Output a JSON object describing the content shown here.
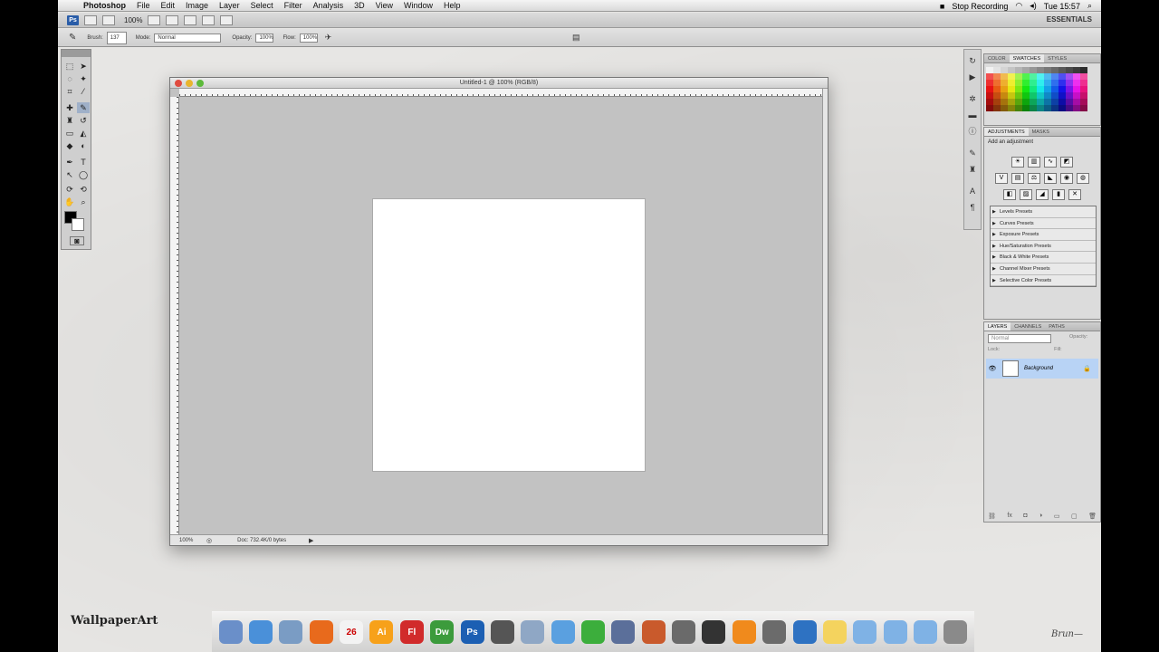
{
  "menubar": {
    "app": "Photoshop",
    "items": [
      "File",
      "Edit",
      "Image",
      "Layer",
      "Select",
      "Filter",
      "Analysis",
      "3D",
      "View",
      "Window",
      "Help"
    ],
    "stop_recording": "Stop Recording",
    "clock": "Tue 15:57"
  },
  "appbar": {
    "zoom": "100%",
    "workspace": "ESSENTIALS"
  },
  "options": {
    "brush_label": "Brush:",
    "brush_size": "137",
    "mode_label": "Mode:",
    "mode_value": "Normal",
    "opacity_label": "Opacity:",
    "opacity_value": "100%",
    "flow_label": "Flow:",
    "flow_value": "100%"
  },
  "document": {
    "title": "Untitled-1 @ 100% (RGB/8)",
    "zoom": "100%",
    "status": "Doc: 732.4K/0 bytes"
  },
  "swatch_panel": {
    "tabs": [
      "COLOR",
      "SWATCHES",
      "STYLES"
    ],
    "active": "SWATCHES"
  },
  "adjust_panel": {
    "tabs": [
      "ADJUSTMENTS",
      "MASKS"
    ],
    "header": "Add an adjustment",
    "presets": [
      "Levels Presets",
      "Curves Presets",
      "Exposure Presets",
      "Hue/Saturation Presets",
      "Black & White Presets",
      "Channel Mixer Presets",
      "Selective Color Presets"
    ]
  },
  "layers_panel": {
    "tabs": [
      "LAYERS",
      "CHANNELS",
      "PATHS"
    ],
    "blend": "Normal",
    "opacity_label": "Opacity:",
    "lock_label": "Lock:",
    "fill_label": "Fill:",
    "layer_name": "Background"
  },
  "dock": {
    "apps": [
      {
        "label": "",
        "color": "#6a8fc9"
      },
      {
        "label": "",
        "color": "#4a90d9"
      },
      {
        "label": "",
        "color": "#7a9cc4"
      },
      {
        "label": "",
        "color": "#e86a1c"
      },
      {
        "label": "26",
        "color": "#f3f3f3"
      },
      {
        "label": "Ai",
        "color": "#f7a11a"
      },
      {
        "label": "Fl",
        "color": "#d12b2b"
      },
      {
        "label": "Dw",
        "color": "#3c9b3c"
      },
      {
        "label": "Ps",
        "color": "#1c5fb3"
      },
      {
        "label": "",
        "color": "#555555"
      },
      {
        "label": "",
        "color": "#8fa7c5"
      },
      {
        "label": "",
        "color": "#5aa0e0"
      },
      {
        "label": "",
        "color": "#3cae3c"
      },
      {
        "label": "",
        "color": "#5b6f9a"
      },
      {
        "label": "",
        "color": "#c95a2c"
      },
      {
        "label": "",
        "color": "#6a6a6a"
      },
      {
        "label": "",
        "color": "#333333"
      },
      {
        "label": "",
        "color": "#f08a1c"
      },
      {
        "label": "",
        "color": "#6b6b6b"
      },
      {
        "label": "",
        "color": "#2e72c2"
      },
      {
        "label": "",
        "color": "#f4d35e"
      },
      {
        "label": "",
        "color": "#7fb2e5"
      },
      {
        "label": "",
        "color": "#7fb2e5"
      },
      {
        "label": "",
        "color": "#7fb2e5"
      },
      {
        "label": "",
        "color": "#8a8a8a"
      }
    ]
  },
  "brand": "WallpaperArt"
}
